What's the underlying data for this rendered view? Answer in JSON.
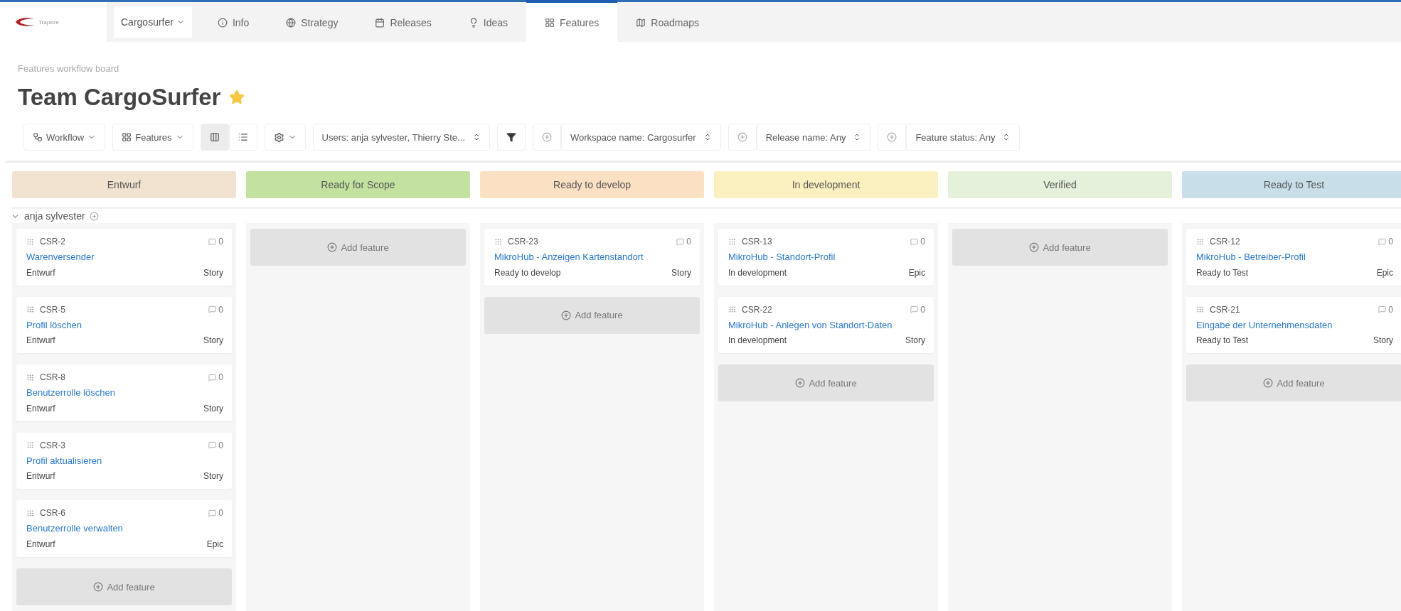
{
  "logo": {
    "text": "Trapeze"
  },
  "workspace_menu": {
    "label": "Cargosurfer"
  },
  "tabs": [
    {
      "label": "Info",
      "selected": false
    },
    {
      "label": "Strategy",
      "selected": false
    },
    {
      "label": "Releases",
      "selected": false
    },
    {
      "label": "Ideas",
      "selected": false
    },
    {
      "label": "Features",
      "selected": true
    },
    {
      "label": "Roadmaps",
      "selected": false
    }
  ],
  "breadcrumb": "Features workflow board",
  "title": "Team CargoSurfer",
  "favorite": true,
  "toolbar": {
    "menus": [
      {
        "label": "Workflow"
      },
      {
        "label": "Features"
      }
    ],
    "views": [
      {
        "selected": true
      },
      {
        "selected": false
      }
    ],
    "users_select": "Users: anja sylvester, Thierry Ste...",
    "filters": [
      {
        "label": "Workspace name: Cargosurfer"
      },
      {
        "label": "Release name: Any"
      },
      {
        "label": "Feature status: Any"
      }
    ]
  },
  "group": {
    "name": "anja sylvester",
    "expanded": true
  },
  "columns": [
    {
      "name": "Entwurf",
      "color": "#f2e2d0",
      "add_label": "Add feature",
      "cards": [
        {
          "id": "CSR-2",
          "comments": "0",
          "title": "Warenversender",
          "status": "Entwurf",
          "type": "Story"
        },
        {
          "id": "CSR-5",
          "comments": "0",
          "title": "Profil löschen",
          "status": "Entwurf",
          "type": "Story"
        },
        {
          "id": "CSR-8",
          "comments": "0",
          "title": "Benutzerrolle löschen",
          "status": "Entwurf",
          "type": "Story"
        },
        {
          "id": "CSR-3",
          "comments": "0",
          "title": "Profil aktualisieren",
          "status": "Entwurf",
          "type": "Story"
        },
        {
          "id": "CSR-6",
          "comments": "0",
          "title": "Benutzerrolle verwalten",
          "status": "Entwurf",
          "type": "Epic"
        }
      ]
    },
    {
      "name": "Ready for Scope",
      "color": "#c3e2a0",
      "add_label": "Add feature"
    },
    {
      "name": "Ready to develop",
      "color": "#fbe0c4",
      "add_label": "Add feature",
      "cards": [
        {
          "id": "CSR-23",
          "comments": "0",
          "title": "MikroHub - Anzeigen Kartenstandort",
          "status": "Ready to develop",
          "type": "Story"
        }
      ]
    },
    {
      "name": "In development",
      "color": "#fbf0bf",
      "add_label": "Add feature",
      "cards": [
        {
          "id": "CSR-13",
          "comments": "0",
          "title": "MikroHub - Standort-Profil",
          "status": "In development",
          "type": "Epic"
        },
        {
          "id": "CSR-22",
          "comments": "0",
          "title": "MikroHub - Anlegen von Standort-Daten",
          "status": "In development",
          "type": "Story"
        }
      ]
    },
    {
      "name": "Verified",
      "color": "#e6f1dc",
      "add_label": "Add feature"
    },
    {
      "name": "Ready to Test",
      "color": "#c8dfe9",
      "add_label": "Add feature",
      "cards": [
        {
          "id": "CSR-12",
          "comments": "0",
          "title": "MikroHub - Betreiber-Profil",
          "status": "Ready to Test",
          "type": "Epic"
        },
        {
          "id": "CSR-21",
          "comments": "0",
          "title": "Eingabe der Unternehmensdaten",
          "status": "Ready to Test",
          "type": "Story"
        }
      ]
    }
  ]
}
